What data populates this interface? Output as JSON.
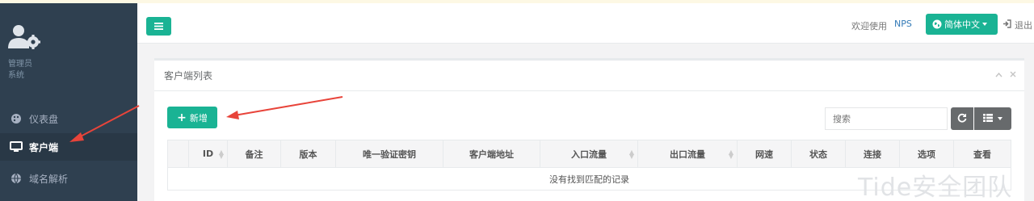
{
  "sidebar": {
    "user_name": "管理员",
    "user_role": "系统",
    "items": [
      {
        "label": "仪表盘",
        "icon": "palette-icon",
        "active": false
      },
      {
        "label": "客户端",
        "icon": "monitor-icon",
        "active": true
      },
      {
        "label": "域名解析",
        "icon": "globe-icon",
        "active": false
      }
    ]
  },
  "header": {
    "welcome": "欢迎使用",
    "app_name": "NPS",
    "language": "简体中文",
    "logout": "退出"
  },
  "panel": {
    "title": "客户端列表",
    "add_label": "新增",
    "search_placeholder": "搜索",
    "columns": [
      "",
      "ID",
      "备注",
      "版本",
      "唯一验证密钥",
      "客户端地址",
      "入口流量",
      "出口流量",
      "网速",
      "状态",
      "连接",
      "选项",
      "查看"
    ],
    "empty_text": "没有找到匹配的记录"
  },
  "watermark": "Tide安全团队",
  "colors": {
    "accent": "#1ab394",
    "sidebar_bg": "#2f4050",
    "arrow": "#e8443a"
  }
}
